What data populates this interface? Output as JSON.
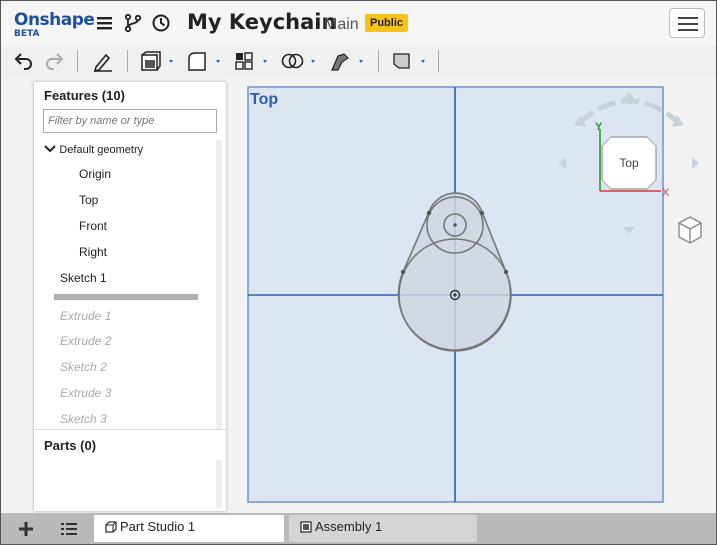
{
  "header": {
    "logo_text": "Onshape",
    "logo_sub": "BETA",
    "document_title": "My Keychain",
    "branch": "Main",
    "visibility_badge": "Public",
    "icons": [
      "menu-icon",
      "branch-icon",
      "history-icon",
      "hamburger-menu-icon"
    ]
  },
  "toolbar": {
    "tools": [
      "undo-icon",
      "redo-icon",
      "sketch-icon",
      "extrude-icon",
      "fillet-icon",
      "pattern-icon",
      "boolean-icon",
      "sweep-icon",
      "plane-icon"
    ]
  },
  "features": {
    "title": "Features (10)",
    "filter_placeholder": "Filter by name or type",
    "group_label": "Default geometry",
    "default_items": [
      "Origin",
      "Top",
      "Front",
      "Right"
    ],
    "active_items": [
      "Sketch 1"
    ],
    "rolled_back_items": [
      "Extrude 1",
      "Extrude 2",
      "Sketch 2",
      "Extrude 3",
      "Sketch 3"
    ]
  },
  "parts": {
    "title": "Parts (0)"
  },
  "viewport": {
    "view_label": "Top",
    "view_cube_label": "Top",
    "axis_x": "X",
    "axis_y": "Y",
    "plane_color": "#dce6f2",
    "sketch_color": "#cfd6df"
  },
  "tabs": {
    "items": [
      {
        "label": "Part Studio 1",
        "active": true
      },
      {
        "label": "Assembly 1",
        "active": false
      }
    ]
  },
  "colors": {
    "brand": "#1f4f9c",
    "badge": "#f7c31a",
    "axis_blue": "#2c5fa8"
  }
}
